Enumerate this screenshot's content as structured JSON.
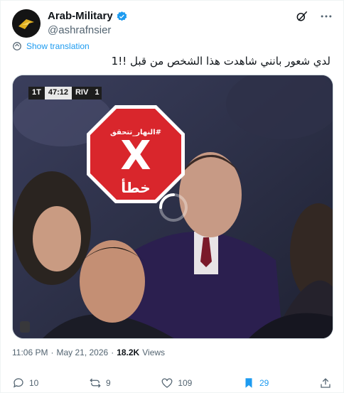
{
  "account": {
    "display_name": "Arab-Military",
    "handle": "@ashrafnsier",
    "verified": true
  },
  "header_icons": [
    "grok-icon",
    "more-icon"
  ],
  "translate_label": "Show translation",
  "tweet_text": "لدي شعور بانني شاهدت هذا الشخص من قبل !!1",
  "video": {
    "scoreboard": {
      "period": "1T",
      "time": "47:12",
      "team": "RIV",
      "extra": "1"
    },
    "stamp": {
      "tag": "#النهار_تتحقق",
      "symbol": "X",
      "word": "خطأ"
    }
  },
  "meta": {
    "time": "11:06 PM",
    "separator": "·",
    "date": "May 21, 2026",
    "views_count": "18.2K",
    "views_label": "Views"
  },
  "actions": {
    "replies": "10",
    "reposts": "9",
    "likes": "109",
    "bookmarks": "29"
  },
  "colors": {
    "accent": "#1d9bf0",
    "stamp_red": "#d9262c",
    "muted": "#536471"
  }
}
